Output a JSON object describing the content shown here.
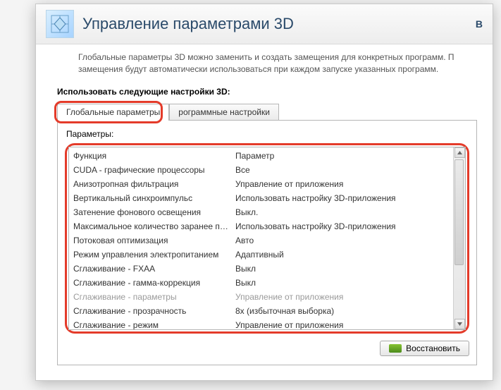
{
  "header": {
    "title": "Управление параметрами 3D",
    "corner": "В"
  },
  "intro": {
    "line1": "Глобальные параметры 3D можно заменить и создать замещения для конкретных программ. П",
    "line2": "замещения будут автоматически использоваться при каждом запуске указанных программ."
  },
  "section_label": "Использовать следующие настройки 3D:",
  "tabs": {
    "global": "Глобальные параметры",
    "program": "рограммные настройки"
  },
  "params_label": "Параметры:",
  "columns": {
    "func": "Функция",
    "param": "Параметр"
  },
  "rows": [
    {
      "func": "CUDA - графические процессоры",
      "param": "Все",
      "disabled": false
    },
    {
      "func": "Анизотропная фильтрация",
      "param": "Управление от приложения",
      "disabled": false
    },
    {
      "func": "Вертикальный синхроимпульс",
      "param": "Использовать настройку 3D-приложения",
      "disabled": false
    },
    {
      "func": "Затенение фонового освещения",
      "param": "Выкл.",
      "disabled": false
    },
    {
      "func": "Максимальное количество заранее под...",
      "param": "Использовать настройку 3D-приложения",
      "disabled": false
    },
    {
      "func": "Потоковая оптимизация",
      "param": "Авто",
      "disabled": false
    },
    {
      "func": "Режим управления электропитанием",
      "param": "Адаптивный",
      "disabled": false
    },
    {
      "func": "Сглаживание - FXAA",
      "param": "Выкл",
      "disabled": false
    },
    {
      "func": "Сглаживание - гамма-коррекция",
      "param": "Выкл",
      "disabled": false
    },
    {
      "func": "Сглаживание - параметры",
      "param": "Управление от приложения",
      "disabled": true
    },
    {
      "func": "Сглаживание - прозрачность",
      "param": "8x (избыточная выборка)",
      "disabled": false
    },
    {
      "func": "Сглаживание - режим",
      "param": "Управление от приложения",
      "disabled": false
    }
  ],
  "restore_label": "Восстановить"
}
